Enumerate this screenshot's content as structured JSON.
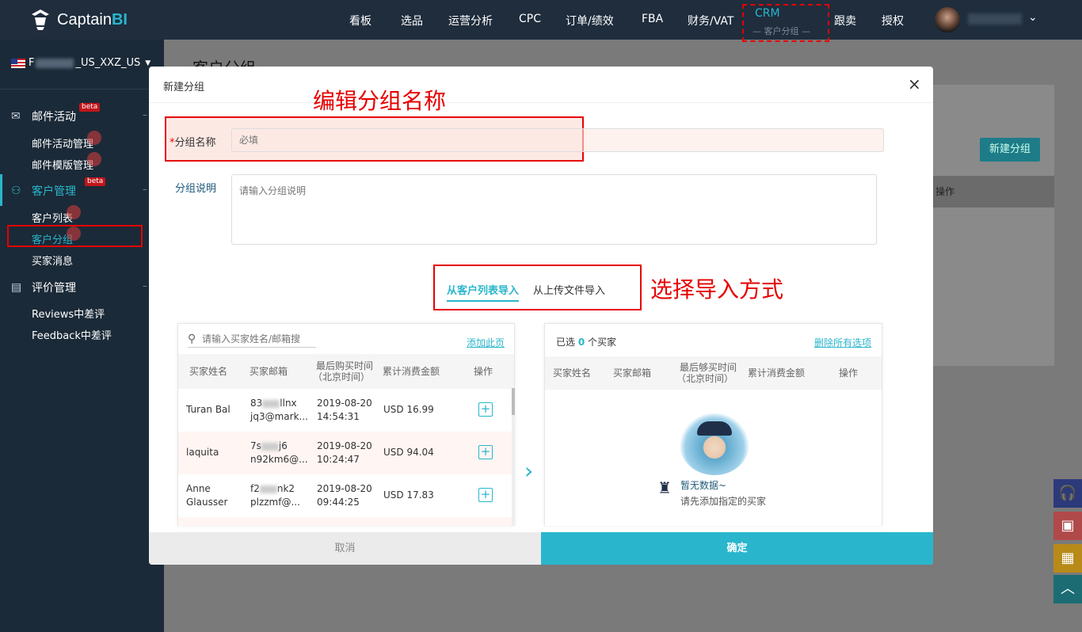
{
  "app": {
    "brand_prefix": "Captain",
    "brand_suffix": "BI"
  },
  "nav": {
    "items": [
      "看板",
      "选品",
      "运营分析",
      "CPC",
      "订单/绩效",
      "FBA",
      "财务/VAT",
      "跟卖",
      "授权"
    ],
    "crm_label": "CRM",
    "crm_sub": "— 客户分组 —",
    "chevron": "⌄"
  },
  "store": {
    "prefix": "F",
    "suffix": "_US_XXZ_US",
    "caret": "▼"
  },
  "sidebar": {
    "group_mail": "邮件活动",
    "group_customer": "客户管理",
    "group_review": "评价管理",
    "beta": "beta",
    "dash": "–",
    "items": {
      "mail_manage": "邮件活动管理",
      "mail_template": "邮件模版管理",
      "customer_list": "客户列表",
      "customer_group": "客户分组",
      "buyer_message": "买家消息",
      "reviews_bad": "Reviews中差评",
      "feedback_bad": "Feedback中差评"
    }
  },
  "page": {
    "title": "客户分组",
    "new_group_button": "新建分组",
    "col_action": "操作"
  },
  "modal": {
    "title": "新建分组",
    "close": "×",
    "annotation_name": "编辑分组名称",
    "annotation_import": "选择导入方式",
    "name_required_mark": "*",
    "name_label": "分组名称",
    "name_placeholder": "必填",
    "desc_label": "分组说明",
    "desc_placeholder": "请输入分组说明",
    "tab_from_list": "从客户列表导入",
    "tab_from_file": "从上传文件导入",
    "left": {
      "search_placeholder": "请输入买家姓名/邮箱搜",
      "add_page": "添加此页",
      "columns": [
        "买家姓名",
        "买家邮箱",
        "最后购买时间",
        "（北京时间）",
        "累计消费金额",
        "操作"
      ],
      "rows": [
        {
          "name": "Turan Bal",
          "email1a": "83",
          "email1b": "llnx",
          "email2": "jq3@mark...",
          "date": "2019-08-20",
          "time": "14:54:31",
          "amount": "USD 16.99"
        },
        {
          "name": "laquita",
          "email1a": "7s",
          "email1b": "j6",
          "email2": "n92km6@...",
          "date": "2019-08-20",
          "time": "10:24:47",
          "amount": "USD 94.04"
        },
        {
          "name": "Anne Glausser",
          "email1a": "f2",
          "email1b": "nk2",
          "email2": "plzzmf@...",
          "date": "2019-08-20",
          "time": "09:44:25",
          "amount": "USD 17.83"
        }
      ],
      "plus": "+"
    },
    "right": {
      "selected_prefix": "已选",
      "selected_count": "0",
      "selected_suffix": "个买家",
      "delete_all": "删除所有选项",
      "columns": [
        "买家姓名",
        "买家邮箱",
        "最后够买时间",
        "（北京时间）",
        "累计消费金额",
        "操作"
      ],
      "empty_title": "暂无数据~",
      "empty_hint": "请先添加指定的买家"
    },
    "arrow": "›",
    "cancel": "取消",
    "confirm": "确定"
  },
  "float_icons": [
    "headset-icon",
    "gift-icon",
    "presentation-icon",
    "arrow-up-icon"
  ],
  "colors": {
    "accent": "#29b6cc",
    "annotation": "#e60000",
    "topbar": "#1f2d3d",
    "sidebar": "#1b2a38"
  }
}
